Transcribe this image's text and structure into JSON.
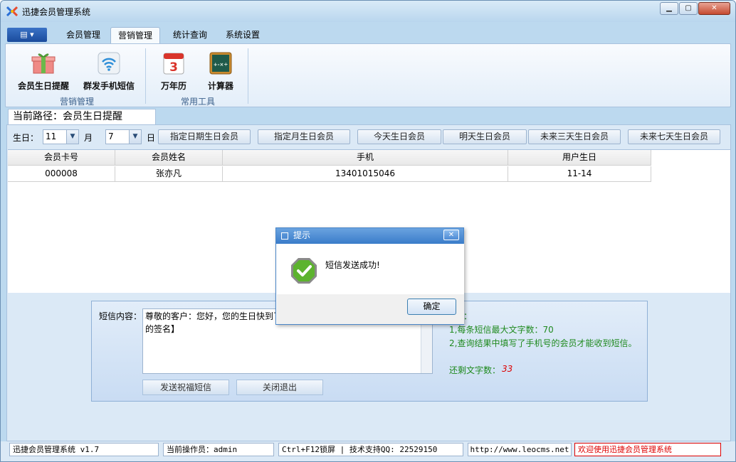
{
  "window": {
    "title": "迅捷会员管理系统",
    "min": "▁",
    "max": "▢",
    "close": "✕"
  },
  "ribbon": {
    "app_menu": "▤ ▾",
    "tabs": [
      "会员管理",
      "营销管理",
      "统计查询",
      "系统设置"
    ],
    "active_tab": "营销管理",
    "groups": [
      {
        "label": "营销管理",
        "items": [
          "会员生日提醒",
          "群发手机短信"
        ]
      },
      {
        "label": "常用工具",
        "items": [
          "万年历",
          "计算器"
        ]
      }
    ],
    "calendar_day": "3"
  },
  "path": {
    "text": "当前路径：会员生日提醒"
  },
  "filter": {
    "day_label": "生日：",
    "month_value": "11",
    "month_label": "月",
    "day_value": "7",
    "day_suffix": "日",
    "buttons": [
      "指定日期生日会员",
      "指定月生日会员",
      "今天生日会员",
      "明天生日会员",
      "未来三天生日会员",
      "未来七天生日会员"
    ]
  },
  "table": {
    "columns": [
      "会员卡号",
      "会员姓名",
      "手机",
      "用户生日"
    ],
    "rows": [
      [
        "000008",
        "张亦凡",
        "13401015046",
        "11-14"
      ]
    ]
  },
  "sms": {
    "label": "短信内容：",
    "text_line1": "尊敬的客户：您好，您的生日快到了",
    "text_line2": "的签名】",
    "send_button": "发送祝福短信",
    "close_button": "关闭退出",
    "hint_title": "示：",
    "hint1": "1,每条短信最大文字数：70",
    "hint2": "2,查询结果中填写了手机号的会员才能收到短信。",
    "remain_label": "还剩文字数：",
    "remain_value": "33"
  },
  "dialog": {
    "title": "提示",
    "close": "✕",
    "message": "短信发送成功!",
    "ok": "确定"
  },
  "status": {
    "version": "迅捷会员管理系统 v1.7",
    "operator": "当前操作员：admin",
    "support": "Ctrl+F12锁屏 | 技术支持QQ:  22529150",
    "url": "http://www.leocms.net",
    "welcome": "欢迎使用迅捷会员管理系统"
  }
}
